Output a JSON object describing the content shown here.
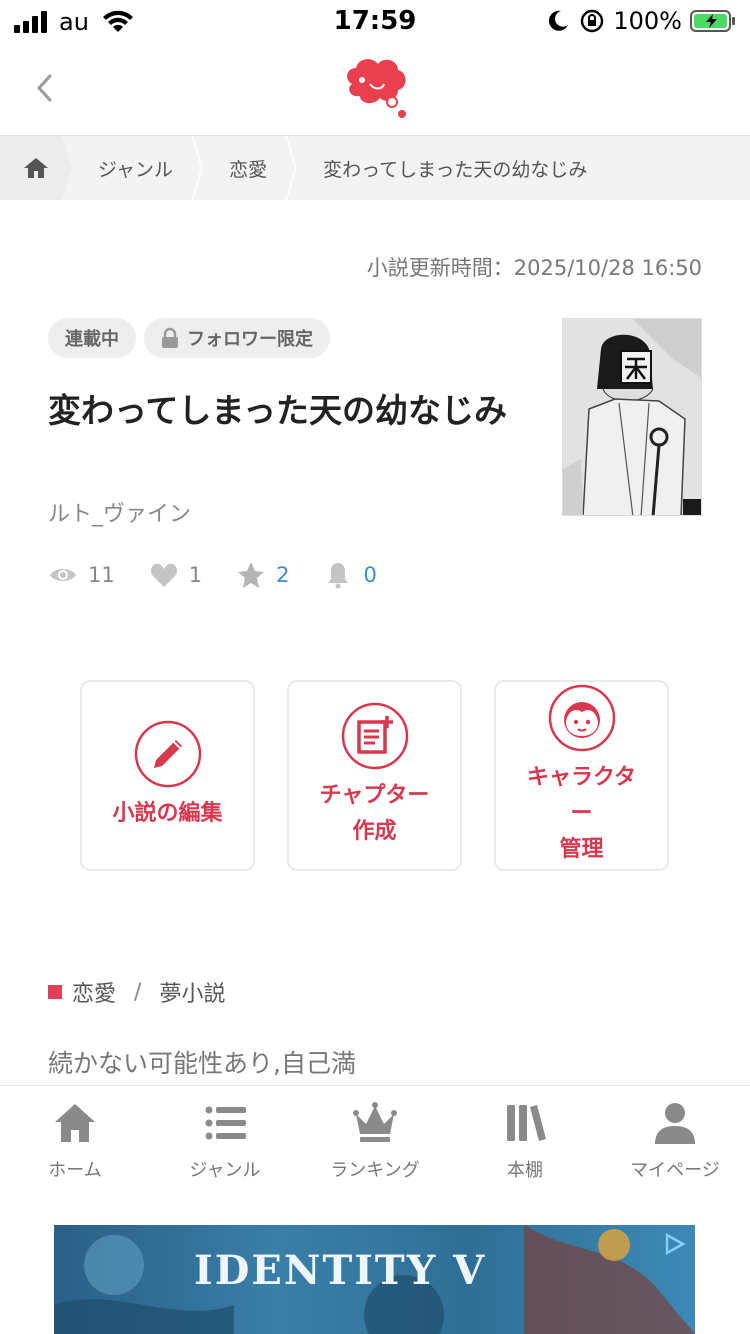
{
  "status_bar": {
    "carrier": "au",
    "time": "17:59",
    "battery_percent": "100%"
  },
  "breadcrumb": {
    "items": [
      "ジャンル",
      "恋愛",
      "変わってしまった天の幼なじみ"
    ]
  },
  "novel": {
    "updated": "小説更新時間：2025/10/28 16:50",
    "tags": [
      "連載中",
      "フォロワー限定"
    ],
    "title": "変わってしまった天の幼なじみ",
    "author": "ルト_ヴァイン",
    "stats": {
      "views": "11",
      "likes": "1",
      "stars": "2",
      "bells": "0"
    }
  },
  "actions": [
    {
      "label": "小説の編集"
    },
    {
      "label": "チャプター\n作成"
    },
    {
      "label": "キャラクタ\nー\n管理"
    }
  ],
  "genre": {
    "primary": "恋愛",
    "separator": "/",
    "secondary": "夢小説"
  },
  "description": "続かない可能性あり,自己満",
  "bottom_nav": [
    {
      "label": "ホーム",
      "icon": "home-icon"
    },
    {
      "label": "ジャンル",
      "icon": "list-icon"
    },
    {
      "label": "ランキング",
      "icon": "crown-icon"
    },
    {
      "label": "本棚",
      "icon": "bookshelf-icon"
    },
    {
      "label": "マイページ",
      "icon": "person-icon"
    }
  ],
  "ad": {
    "text": "IDENTITY V"
  },
  "colors": {
    "accent": "#d8384e",
    "brand": "#e8404e",
    "link_blue": "#3b8fc9"
  }
}
